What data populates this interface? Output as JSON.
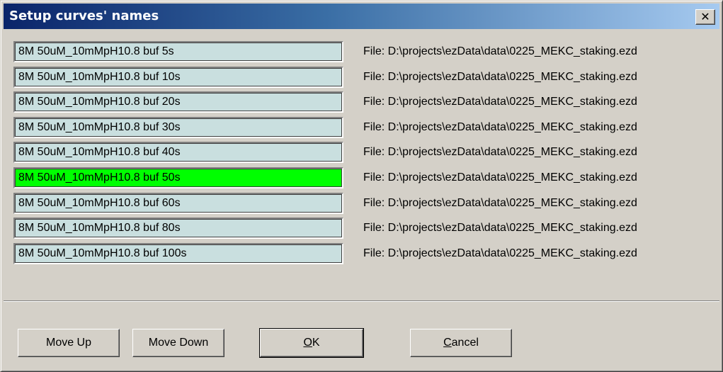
{
  "window": {
    "title": "Setup curves' names",
    "close_glyph": "✕"
  },
  "curves": [
    {
      "name": "8M 50uM_10mMpH10.8 buf 5s",
      "file": "File: D:\\projects\\ezData\\data\\0225_MEKC_staking.ezd",
      "selected": false
    },
    {
      "name": "8M 50uM_10mMpH10.8 buf 10s",
      "file": "File: D:\\projects\\ezData\\data\\0225_MEKC_staking.ezd",
      "selected": false
    },
    {
      "name": "8M 50uM_10mMpH10.8 buf 20s",
      "file": "File: D:\\projects\\ezData\\data\\0225_MEKC_staking.ezd",
      "selected": false
    },
    {
      "name": "8M 50uM_10mMpH10.8 buf 30s",
      "file": "File: D:\\projects\\ezData\\data\\0225_MEKC_staking.ezd",
      "selected": false
    },
    {
      "name": "8M 50uM_10mMpH10.8 buf 40s",
      "file": "File: D:\\projects\\ezData\\data\\0225_MEKC_staking.ezd",
      "selected": false
    },
    {
      "name": "8M 50uM_10mMpH10.8 buf 50s",
      "file": "File: D:\\projects\\ezData\\data\\0225_MEKC_staking.ezd",
      "selected": true
    },
    {
      "name": "8M 50uM_10mMpH10.8 buf 60s",
      "file": "File: D:\\projects\\ezData\\data\\0225_MEKC_staking.ezd",
      "selected": false
    },
    {
      "name": "8M 50uM_10mMpH10.8 buf 80s",
      "file": "File: D:\\projects\\ezData\\data\\0225_MEKC_staking.ezd",
      "selected": false
    },
    {
      "name": "8M 50uM_10mMpH10.8 buf 100s",
      "file": "File: D:\\projects\\ezData\\data\\0225_MEKC_staking.ezd",
      "selected": false
    }
  ],
  "buttons": {
    "move_up": "Move Up",
    "move_down": "Move Down",
    "ok_accel": "O",
    "ok_rest": "K",
    "cancel_accel": "C",
    "cancel_rest": "ancel"
  },
  "colors": {
    "selected_field": "#00ff00",
    "field_background": "#c9dfdf",
    "titlebar_start": "#0a246a",
    "titlebar_end": "#a6caf0"
  }
}
